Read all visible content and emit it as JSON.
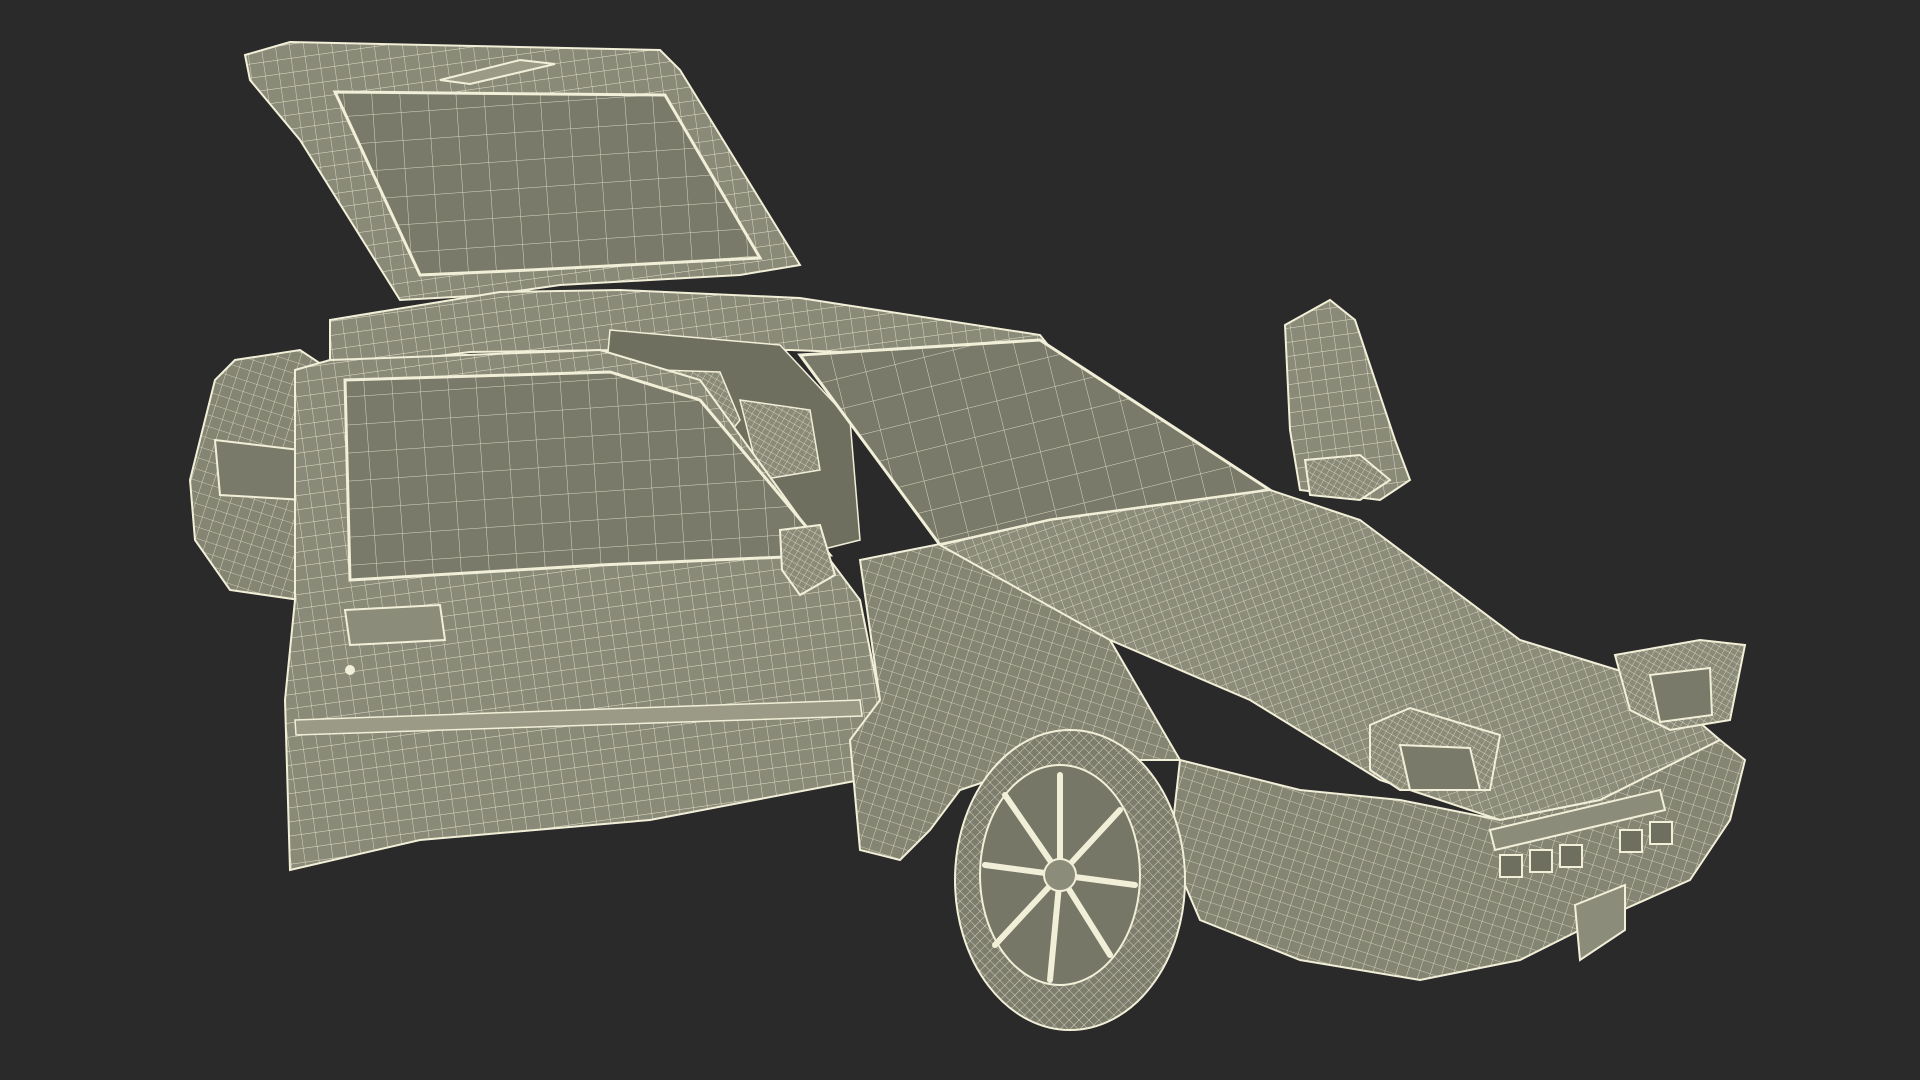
{
  "scene": {
    "subject": "wireframe-car-model",
    "background_color": "#2a2a2a",
    "surface_color": "#8a8a78",
    "surface_dark_color": "#6f6f60",
    "wire_color": "#f2efd8",
    "glass_color": "#7a7a6a",
    "hatch_open": true,
    "driver_door_open": true,
    "passenger_door_open": true,
    "headlights_popped_up": true
  }
}
